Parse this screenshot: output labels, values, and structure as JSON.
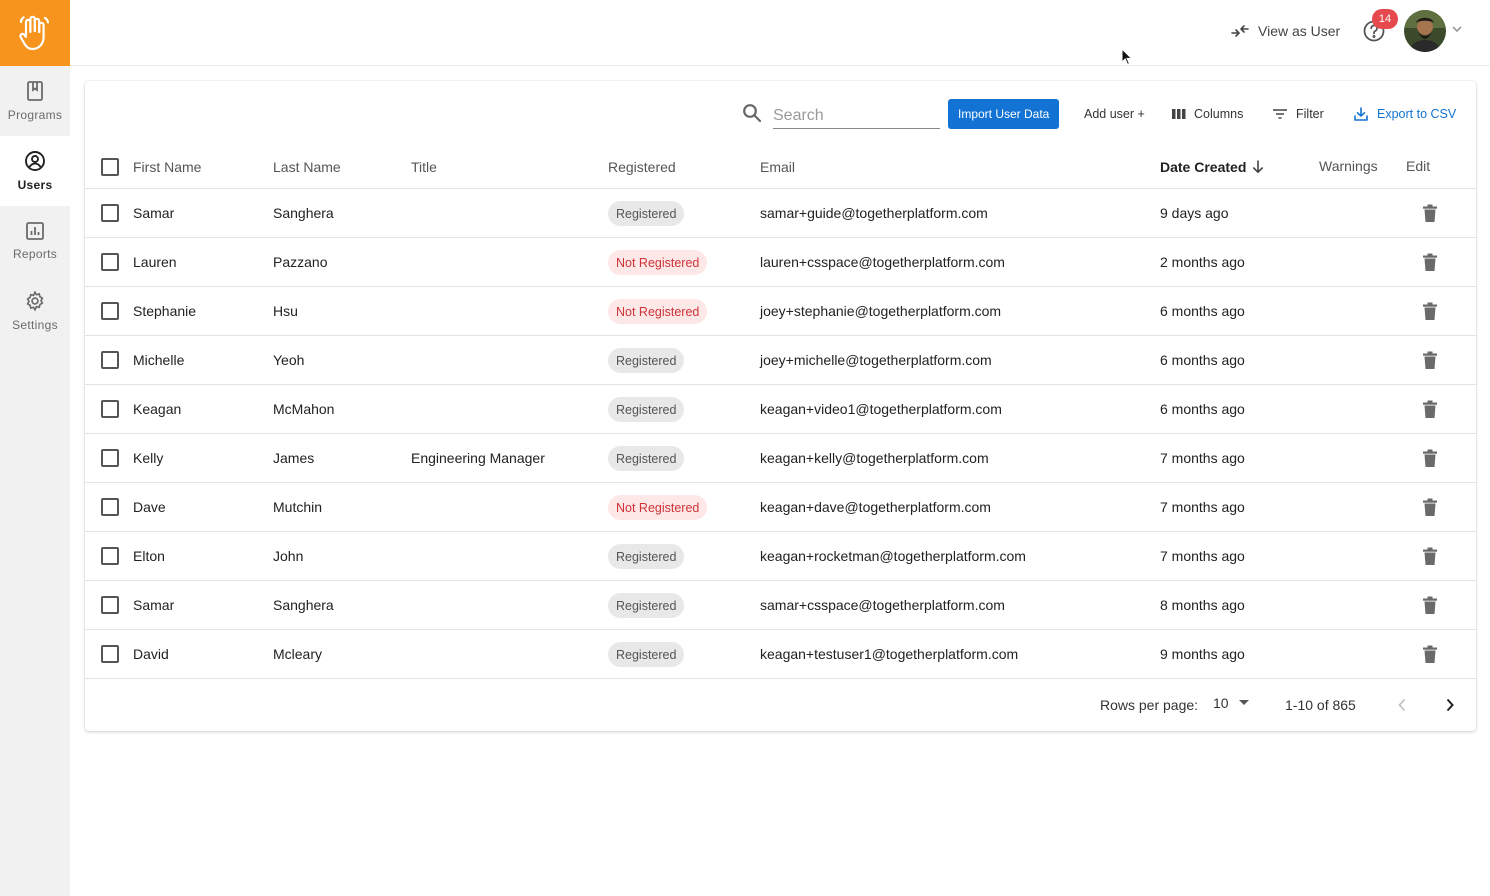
{
  "sidebar": {
    "logo": "hand-logo",
    "items": [
      {
        "label": "Programs",
        "icon": "bookmark-icon"
      },
      {
        "label": "Users",
        "icon": "user-circle-icon",
        "active": true
      },
      {
        "label": "Reports",
        "icon": "bar-chart-icon"
      },
      {
        "label": "Settings",
        "icon": "gear-icon"
      }
    ]
  },
  "header": {
    "view_as_user": "View as User",
    "notification_count": "14",
    "help_icon": "help-circle-icon"
  },
  "toolbar": {
    "search_placeholder": "Search",
    "import_label": "Import User Data",
    "add_user_label": "Add user +",
    "columns_label": "Columns",
    "filter_label": "Filter",
    "export_label": "Export to CSV"
  },
  "table": {
    "columns": {
      "first_name": "First Name",
      "last_name": "Last Name",
      "title": "Title",
      "registered": "Registered",
      "email": "Email",
      "date_created": "Date Created",
      "warnings": "Warnings",
      "edit": "Edit"
    },
    "rows": [
      {
        "first": "Samar",
        "last": "Sanghera",
        "title": "",
        "status": "Registered",
        "email": "samar+guide@togetherplatform.com",
        "created": "9 days ago"
      },
      {
        "first": "Lauren",
        "last": "Pazzano",
        "title": "",
        "status": "Not Registered",
        "email": "lauren+csspace@togetherplatform.com",
        "created": "2 months ago"
      },
      {
        "first": "Stephanie",
        "last": "Hsu",
        "title": "",
        "status": "Not Registered",
        "email": "joey+stephanie@togetherplatform.com",
        "created": "6 months ago"
      },
      {
        "first": "Michelle",
        "last": "Yeoh",
        "title": "",
        "status": "Registered",
        "email": "joey+michelle@togetherplatform.com",
        "created": "6 months ago"
      },
      {
        "first": "Keagan",
        "last": "McMahon",
        "title": "",
        "status": "Registered",
        "email": "keagan+video1@togetherplatform.com",
        "created": "6 months ago"
      },
      {
        "first": "Kelly",
        "last": "James",
        "title": "Engineering Manager",
        "status": "Registered",
        "email": "keagan+kelly@togetherplatform.com",
        "created": "7 months ago"
      },
      {
        "first": "Dave",
        "last": "Mutchin",
        "title": "",
        "status": "Not Registered",
        "email": "keagan+dave@togetherplatform.com",
        "created": "7 months ago"
      },
      {
        "first": "Elton",
        "last": "John",
        "title": "",
        "status": "Registered",
        "email": "keagan+rocketman@togetherplatform.com",
        "created": "7 months ago"
      },
      {
        "first": "Samar",
        "last": "Sanghera",
        "title": "",
        "status": "Registered",
        "email": "samar+csspace@togetherplatform.com",
        "created": "8 months ago"
      },
      {
        "first": "David",
        "last": "Mcleary",
        "title": "",
        "status": "Registered",
        "email": "keagan+testuser1@togetherplatform.com",
        "created": "9 months ago"
      }
    ]
  },
  "pagination": {
    "rows_per_page_label": "Rows per page:",
    "rows_per_page_value": "10",
    "range": "1-10 of 865"
  },
  "colors": {
    "brand_orange": "#f7941d",
    "primary_blue": "#1273d4",
    "not_registered_red": "#d0343a",
    "badge_red": "#e5484d"
  }
}
